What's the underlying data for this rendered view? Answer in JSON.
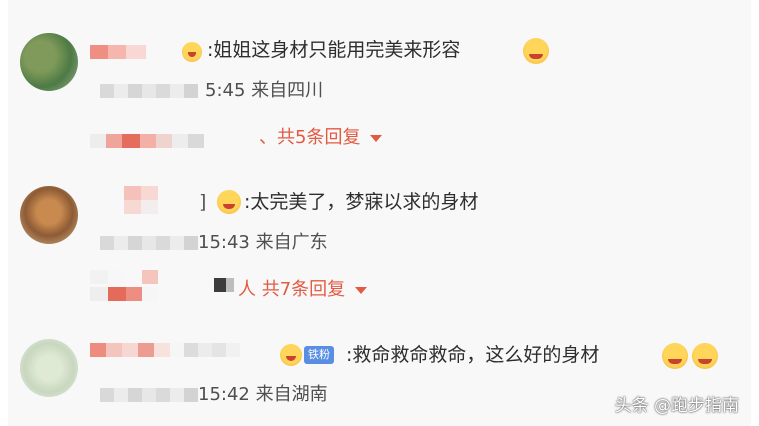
{
  "comments": [
    {
      "text": ":姐姐这身材只能用完美来形容",
      "meta": "5:45 来自四川",
      "reply_label": "、共5条回复"
    },
    {
      "text": ":太完美了，梦寐以求的身材",
      "meta": "15:43 来自广东",
      "reply_label": "人 共7条回复"
    },
    {
      "text": ":救命救命救命，这么好的身材",
      "meta": "15:42 来自湖南",
      "badge": "铁粉"
    }
  ],
  "watermark": "头条 @跑步指南",
  "icons": {
    "emoji": "emoji-icon",
    "badge": "fan-badge-icon",
    "caret": "chevron-down-icon"
  },
  "colors": {
    "reply": "#e35a43",
    "text": "#2e2e2e",
    "meta": "#4f4f4f",
    "background": "#f8f8f8"
  }
}
